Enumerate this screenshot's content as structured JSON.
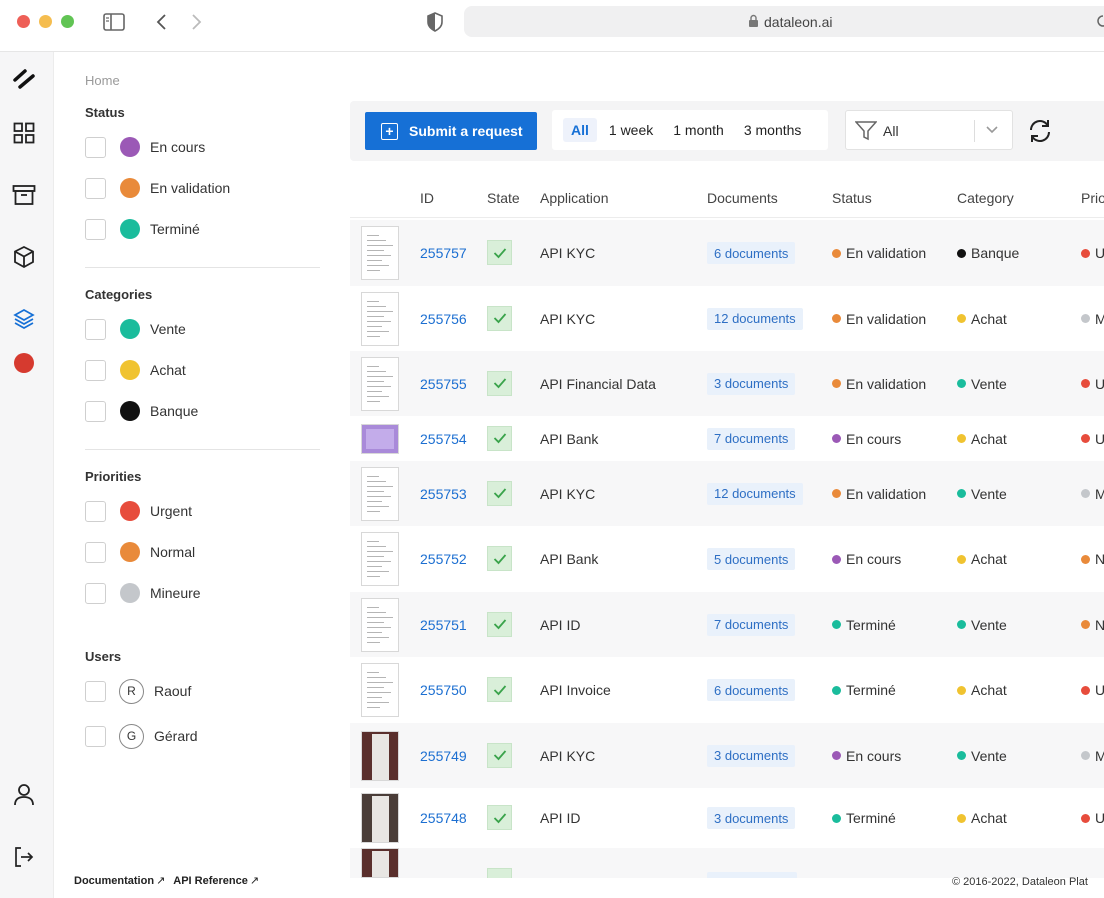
{
  "browser": {
    "url": "dataleon.ai"
  },
  "breadcrumb": "Home",
  "filters": {
    "status": {
      "title": "Status",
      "options": [
        {
          "label": "En cours",
          "color": "#9b59b6"
        },
        {
          "label": "En validation",
          "color": "#e98a3a"
        },
        {
          "label": "Terminé",
          "color": "#1abc9c"
        }
      ]
    },
    "categories": {
      "title": "Categories",
      "options": [
        {
          "label": "Vente",
          "color": "#1abc9c"
        },
        {
          "label": "Achat",
          "color": "#f0c330"
        },
        {
          "label": "Banque",
          "color": "#111111"
        }
      ]
    },
    "priorities": {
      "title": "Priorities",
      "options": [
        {
          "label": "Urgent",
          "color": "#e74c3c"
        },
        {
          "label": "Normal",
          "color": "#e98a3a"
        },
        {
          "label": "Mineure",
          "color": "#c4c7cb"
        }
      ]
    },
    "users": {
      "title": "Users",
      "options": [
        {
          "initial": "R",
          "label": "Raouf"
        },
        {
          "initial": "G",
          "label": "Gérard"
        }
      ]
    }
  },
  "footer": {
    "documentation": "Documentation",
    "api_reference": "API Reference",
    "copyright": "© 2016-2022, Dataleon Plat"
  },
  "toolbar": {
    "submit_label": "Submit a request",
    "periods": [
      "All",
      "1 week",
      "1 month",
      "3 months"
    ],
    "active_period": "All",
    "filter_value": "All"
  },
  "table": {
    "columns": [
      "ID",
      "State",
      "Application",
      "Documents",
      "Status",
      "Category",
      "Prio"
    ],
    "rows": [
      {
        "id": "255757",
        "application": "API KYC",
        "documents": "6 documents",
        "status": "En validation",
        "status_color": "#e98a3a",
        "category": "Banque",
        "category_color": "#111111",
        "priority": "U",
        "priority_color": "#e74c3c"
      },
      {
        "id": "255756",
        "application": "API KYC",
        "documents": "12 documents",
        "status": "En validation",
        "status_color": "#e98a3a",
        "category": "Achat",
        "category_color": "#f0c330",
        "priority": "M",
        "priority_color": "#c4c7cb"
      },
      {
        "id": "255755",
        "application": "API Financial Data",
        "documents": "3 documents",
        "status": "En validation",
        "status_color": "#e98a3a",
        "category": "Vente",
        "category_color": "#1abc9c",
        "priority": "U",
        "priority_color": "#e74c3c"
      },
      {
        "id": "255754",
        "application": "API Bank",
        "documents": "7 documents",
        "status": "En cours",
        "status_color": "#9b59b6",
        "category": "Achat",
        "category_color": "#f0c330",
        "priority": "U",
        "priority_color": "#e74c3c"
      },
      {
        "id": "255753",
        "application": "API KYC",
        "documents": "12 documents",
        "status": "En validation",
        "status_color": "#e98a3a",
        "category": "Vente",
        "category_color": "#1abc9c",
        "priority": "M",
        "priority_color": "#c4c7cb"
      },
      {
        "id": "255752",
        "application": "API Bank",
        "documents": "5 documents",
        "status": "En cours",
        "status_color": "#9b59b6",
        "category": "Achat",
        "category_color": "#f0c330",
        "priority": "N",
        "priority_color": "#e98a3a"
      },
      {
        "id": "255751",
        "application": "API ID",
        "documents": "7 documents",
        "status": "Terminé",
        "status_color": "#1abc9c",
        "category": "Vente",
        "category_color": "#1abc9c",
        "priority": "N",
        "priority_color": "#e98a3a"
      },
      {
        "id": "255750",
        "application": "API Invoice",
        "documents": "6 documents",
        "status": "Terminé",
        "status_color": "#1abc9c",
        "category": "Achat",
        "category_color": "#f0c330",
        "priority": "U",
        "priority_color": "#e74c3c"
      },
      {
        "id": "255749",
        "application": "API KYC",
        "documents": "3 documents",
        "status": "En cours",
        "status_color": "#9b59b6",
        "category": "Vente",
        "category_color": "#1abc9c",
        "priority": "M",
        "priority_color": "#c4c7cb"
      },
      {
        "id": "255748",
        "application": "API ID",
        "documents": "3 documents",
        "status": "Terminé",
        "status_color": "#1abc9c",
        "category": "Achat",
        "category_color": "#f0c330",
        "priority": "U",
        "priority_color": "#e74c3c"
      }
    ]
  },
  "colors": {
    "accent": "#1670d6",
    "rail_active": "#1670d6",
    "rail_record": "#d63a2f"
  }
}
